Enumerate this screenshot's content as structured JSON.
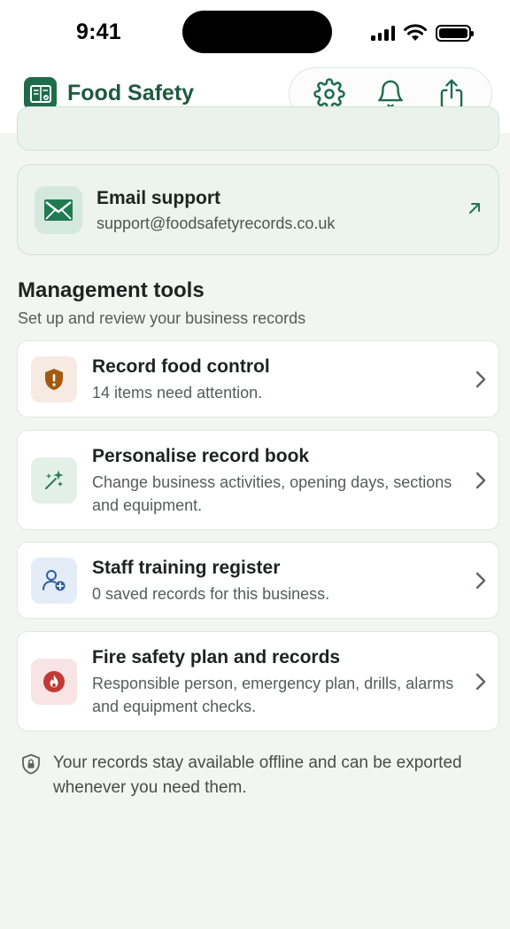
{
  "status_bar": {
    "time": "9:41"
  },
  "header": {
    "app_title": "Food Safety",
    "actions": [
      "settings",
      "notifications",
      "share"
    ]
  },
  "support": {
    "title": "Email support",
    "email": "support@foodsafetyrecords.co.uk"
  },
  "management": {
    "title": "Management tools",
    "subtitle": "Set up and review your business records",
    "items": [
      {
        "title": "Record food control",
        "desc": "14 items need attention.",
        "icon": "shield-alert-icon",
        "icon_bg": "#f6eae2",
        "icon_color": "#a35a0f"
      },
      {
        "title": "Personalise record book",
        "desc": "Change business activities, opening days, sections and equipment.",
        "icon": "magic-wand-icon",
        "icon_bg": "#e3f0e8",
        "icon_color": "#2e7a55"
      },
      {
        "title": "Staff training register",
        "desc": "0 saved records for this business.",
        "icon": "user-add-icon",
        "icon_bg": "#e4edf7",
        "icon_color": "#2f5f9b"
      },
      {
        "title": "Fire safety plan and records",
        "desc": "Responsible person, emergency plan, drills, alarms and equipment checks.",
        "icon": "fire-icon",
        "icon_bg": "#f8e4e4",
        "icon_color": "#c13a34"
      }
    ]
  },
  "footer": {
    "note": "Your records stay available offline and can be exported whenever you need them."
  },
  "colors": {
    "brand": "#1f6b4c",
    "background": "#f3f5f3"
  }
}
